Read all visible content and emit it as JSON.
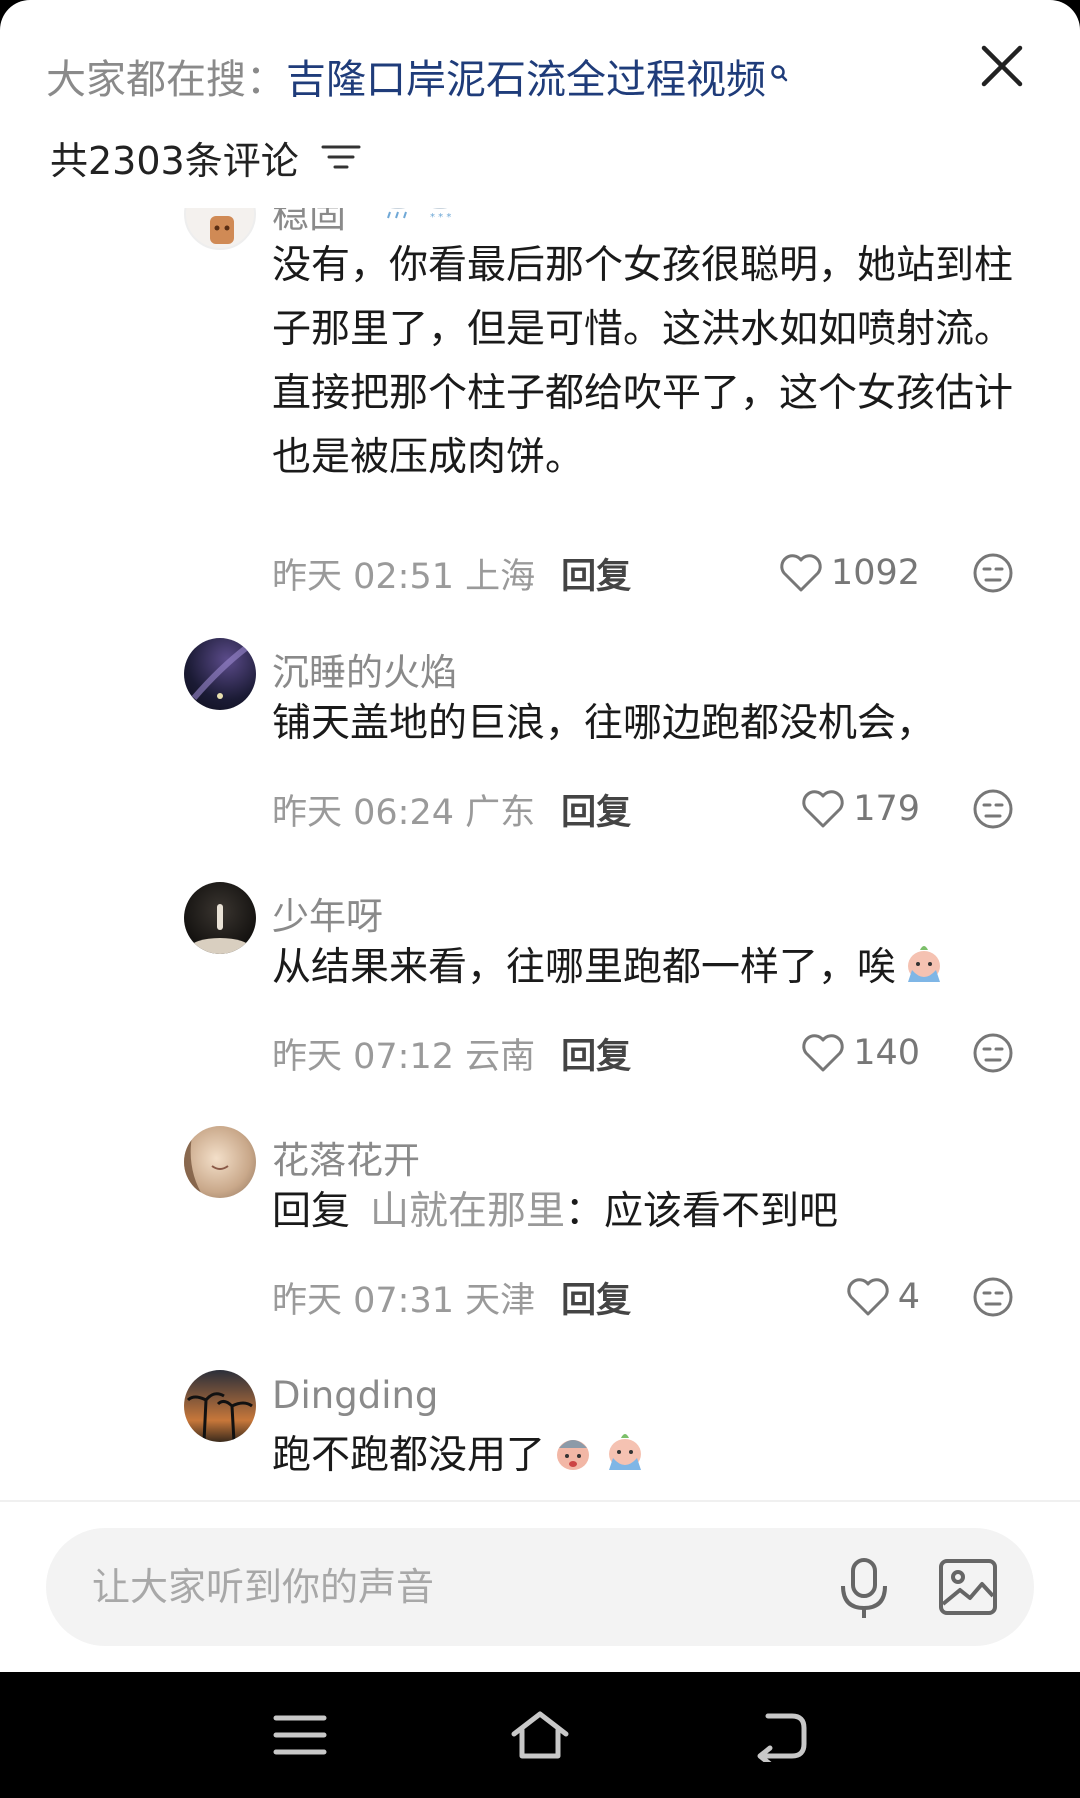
{
  "header": {
    "search_prefix": "大家都在搜：",
    "search_query": "吉隆口岸泥石流全过程视频",
    "comment_count": "共2303条评论"
  },
  "comments": [
    {
      "username": "稳固",
      "content": "没有，你看最后那个女孩很聪明，她站到柱子那里了，但是可惜。这洪水如如喷射流。直接把那个柱子都给吹平了，这个女孩估计也是被压成肉饼。",
      "time": "昨天 02:51",
      "location": "上海",
      "reply_label": "回复",
      "likes": "1092"
    },
    {
      "username": "沉睡的火焰",
      "content": "铺天盖地的巨浪，往哪边跑都没机会，",
      "time": "昨天 06:24",
      "location": "广东",
      "reply_label": "回复",
      "likes": "179"
    },
    {
      "username": "少年呀",
      "content": "从结果来看，往哪里跑都一样了，唉",
      "time": "昨天 07:12",
      "location": "云南",
      "reply_label": "回复",
      "likes": "140"
    },
    {
      "username": "花落花开",
      "reply_prefix": "回复",
      "reply_to": "山就在那里",
      "content": "：应该看不到吧",
      "time": "昨天 07:31",
      "location": "天津",
      "reply_label": "回复",
      "likes": "4"
    },
    {
      "username": "Dingding",
      "content": "跑不跑都没用了"
    }
  ],
  "input": {
    "placeholder": "让大家听到你的声音"
  },
  "icons": [
    "search-icon",
    "close-icon",
    "sort-icon",
    "heart-icon",
    "dislike-icon",
    "mic-icon",
    "image-icon",
    "menu-icon",
    "home-icon",
    "back-icon"
  ]
}
